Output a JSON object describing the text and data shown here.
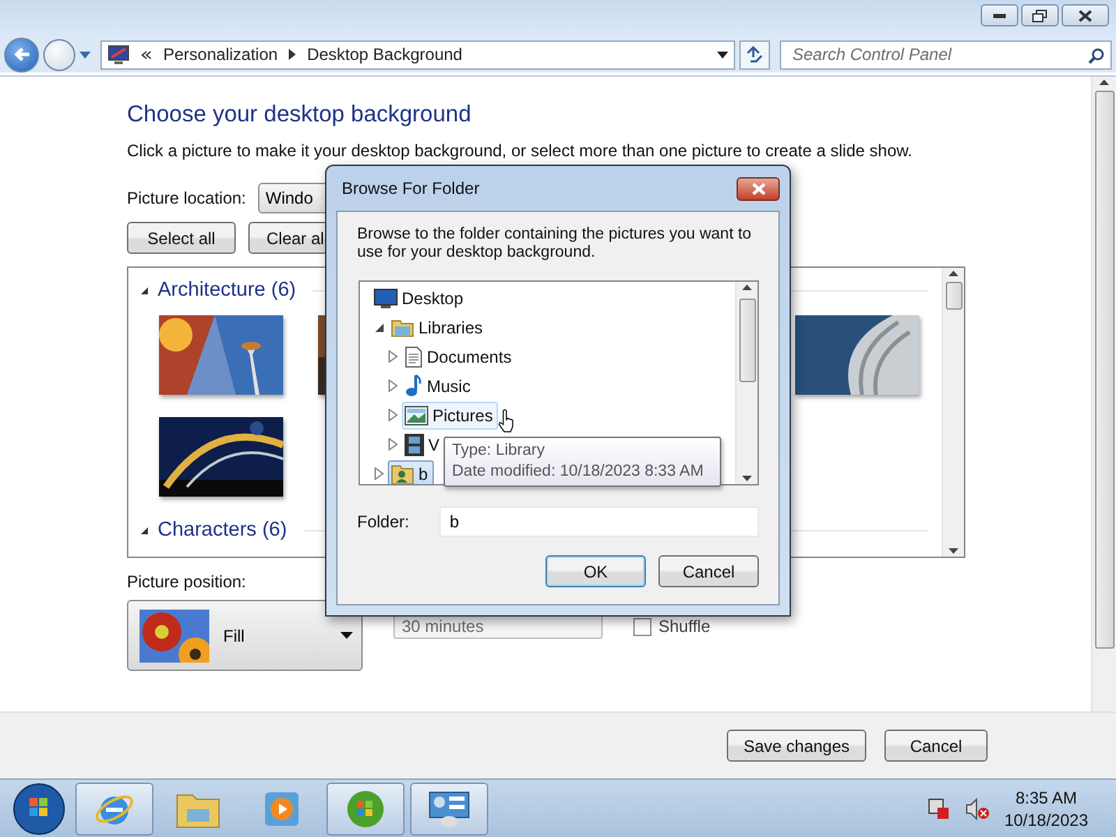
{
  "address_bar": {
    "breadcrumbs": [
      "Personalization",
      "Desktop Background"
    ],
    "search": {
      "placeholder": "Search Control Panel"
    }
  },
  "page": {
    "heading": "Choose your desktop background",
    "description": "Click a picture to make it your desktop background, or select more than one picture to create a slide show.",
    "picture_location": {
      "label": "Picture location:",
      "value": "Windo"
    },
    "buttons": [
      "Select all",
      "Clear al"
    ],
    "groups": [
      {
        "title": "Architecture (6)",
        "expanded": true
      },
      {
        "title": "Characters (6)",
        "expanded": true
      }
    ],
    "picture_position": {
      "label": "Picture position:",
      "value": "Fill"
    },
    "interval": {
      "value": "30 minutes",
      "disabled": true
    },
    "shuffle": {
      "label": "Shuffle",
      "checked": false
    }
  },
  "footer": {
    "buttons": [
      "Save changes",
      "Cancel"
    ]
  },
  "dialog": {
    "title": "Browse For Folder",
    "text": "Browse to the folder containing the pictures you want to use for your desktop background.",
    "tree": [
      {
        "label": "Desktop",
        "kind": "desktop",
        "selected": false,
        "hovered": false,
        "children": [
          {
            "label": "Libraries",
            "kind": "library",
            "selected": false,
            "hovered": false,
            "expanded": true,
            "children": [
              {
                "label": "Documents",
                "kind": "documents",
                "selected": false,
                "hovered": false,
                "expanded": false
              },
              {
                "label": "Music",
                "kind": "music",
                "selected": false,
                "hovered": false,
                "expanded": false
              },
              {
                "label": "Pictures",
                "kind": "pictures",
                "selected": false,
                "hovered": true,
                "expanded": false
              },
              {
                "label": "V",
                "kind": "videos",
                "selected": false,
                "hovered": false,
                "expanded": false
              }
            ]
          },
          {
            "label": "b",
            "kind": "user",
            "selected": true,
            "hovered": false,
            "expanded": false
          }
        ]
      }
    ],
    "folder": {
      "label": "Folder:",
      "value": "b"
    },
    "buttons": [
      {
        "label": "OK",
        "default": true
      },
      {
        "label": "Cancel",
        "default": false
      }
    ],
    "tooltip": [
      "Type: Library",
      "Date modified: 10/18/2023 8:33 AM"
    ]
  },
  "taskbar": {
    "items": [
      {
        "kind": "browser",
        "running": true
      },
      {
        "kind": "folder",
        "running": false
      },
      {
        "kind": "media",
        "running": false
      },
      {
        "kind": "orb",
        "running": true
      },
      {
        "kind": "control-panel",
        "running": true
      }
    ],
    "time": "8:35 AM",
    "date": "10/18/2023"
  }
}
